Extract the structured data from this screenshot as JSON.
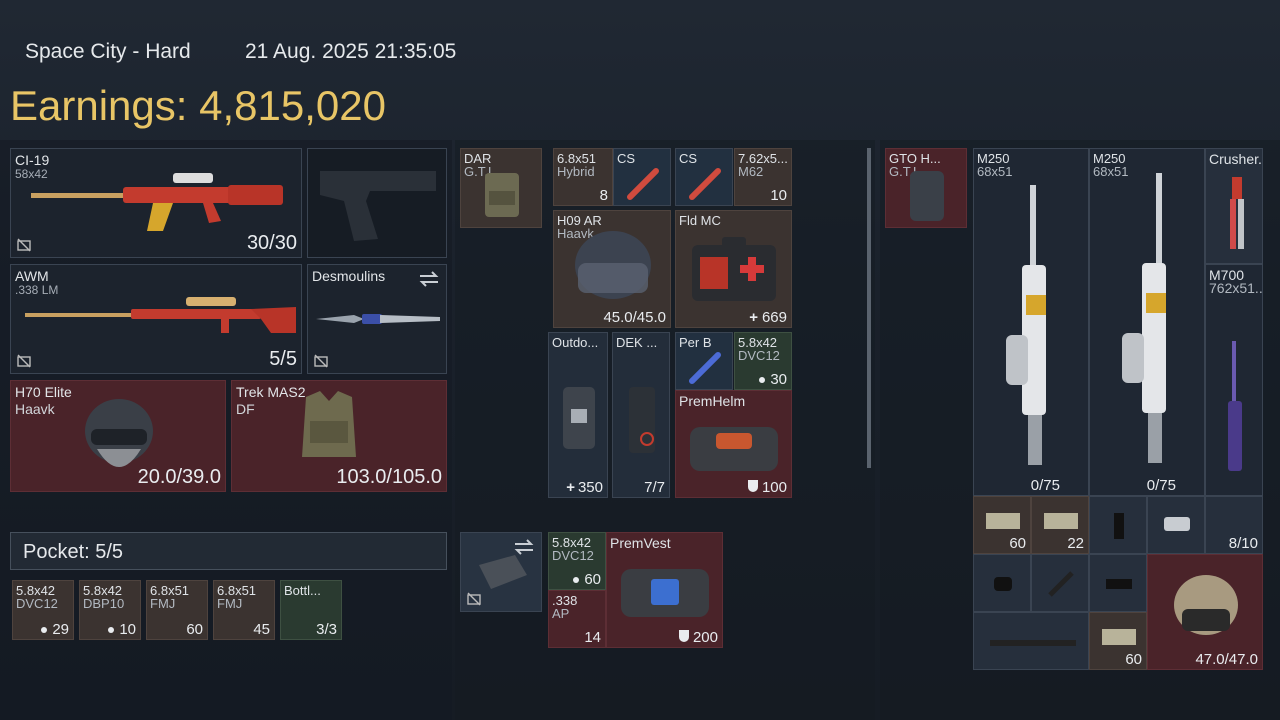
{
  "header": {
    "location": "Space City - Hard",
    "datetime": "21 Aug. 2025 21:35:05",
    "earnings_label": "Earnings: 4,815,020"
  },
  "loadout": {
    "primary": {
      "name": "CI-19",
      "sub": "58x42",
      "count": "30/30"
    },
    "secondary": {
      "name": "AWM",
      "sub": ".338 LM",
      "count": "5/5"
    },
    "melee": {
      "name": "Desmoulins"
    },
    "helmet": {
      "name": "H70 Elite",
      "sub": "Haavk",
      "count": "20.0/39.0"
    },
    "armor": {
      "name": "Trek MAS2",
      "sub": "DF",
      "count": "103.0/105.0"
    },
    "pocket_label": "Pocket: 5/5",
    "pocket_items": [
      {
        "name": "5.8x42",
        "sub": "DVC12",
        "count": "29",
        "dot": true
      },
      {
        "name": "5.8x42",
        "sub": "DBP10",
        "count": "10",
        "dot": true
      },
      {
        "name": "6.8x51",
        "sub": "FMJ",
        "count": "60",
        "dot": false
      },
      {
        "name": "6.8x51",
        "sub": "FMJ",
        "count": "45",
        "dot": false
      },
      {
        "name": "Bottl...",
        "sub": "",
        "count": "3/3",
        "dot": false
      }
    ]
  },
  "rig": {
    "slot": {
      "name": "DAR",
      "sub": "G.T.I."
    },
    "items": {
      "a1": {
        "name": "6.8x51",
        "sub": "Hybrid",
        "count": "8"
      },
      "a2": {
        "name": "CS"
      },
      "a3": {
        "name": "CS"
      },
      "a4": {
        "name": "7.62x5...",
        "sub": "M62",
        "count": "10"
      },
      "b1": {
        "name": "H09 AR",
        "sub": "Haavk",
        "count": "45.0/45.0"
      },
      "b2": {
        "name": "Fld MC",
        "count": "669"
      },
      "c1": {
        "name": "Outdo...",
        "count": "350"
      },
      "c2": {
        "name": "DEK ...",
        "count": "7/7"
      },
      "c3": {
        "name": "Per B"
      },
      "c4": {
        "name": "5.8x42",
        "sub": "DVC12",
        "count": "30"
      },
      "c5": {
        "name": "PremHelm",
        "count": "100"
      }
    }
  },
  "case": {
    "items": {
      "d1": {
        "name": "5.8x42",
        "sub": "DVC12",
        "count": "60"
      },
      "d2": {
        "name": ".338",
        "sub": "AP",
        "count": "14"
      },
      "d3": {
        "name": "PremVest",
        "count": "200"
      }
    }
  },
  "backpack": {
    "slot": {
      "name": "GTO H...",
      "sub": "G.T.I."
    },
    "items": {
      "e1": {
        "name": "M250",
        "sub": "68x51",
        "count": "0/75"
      },
      "e2": {
        "name": "M250",
        "sub": "68x51",
        "count": "0/75"
      },
      "e3": {
        "name": "Crusher..."
      },
      "e4": {
        "name": "M700",
        "sub": "762x51..."
      },
      "f1": {
        "count": "60"
      },
      "f2": {
        "count": "22"
      },
      "f3": {
        "count": "8/10"
      },
      "g1": {
        "count": "60"
      },
      "g2": {
        "count": "47.0/47.0"
      }
    }
  },
  "colors": {
    "accent": "#e8c566",
    "red_slot": "#4a2329",
    "panel": "#1c232d"
  }
}
